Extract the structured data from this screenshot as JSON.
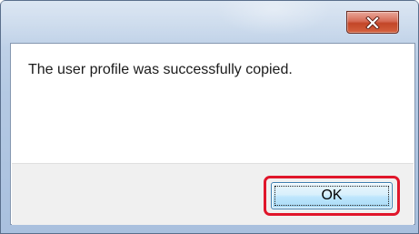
{
  "dialog": {
    "message": "The user profile was successfully copied.",
    "ok_label": "OK",
    "close_icon": "close-x-icon",
    "colors": {
      "close_button": "#c9482b",
      "highlight": "#e0162b",
      "frame": "#b4c9e3"
    }
  }
}
